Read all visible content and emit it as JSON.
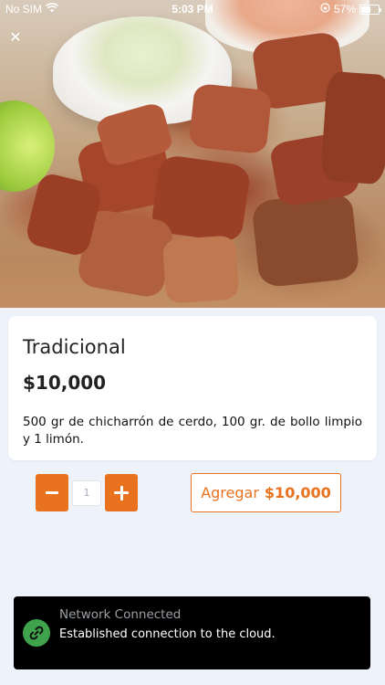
{
  "status_bar": {
    "carrier": "No SIM",
    "time": "5:03 PM",
    "battery_percent": "57%",
    "battery_level": 0.57
  },
  "product": {
    "name": "Tradicional",
    "price": "$10,000",
    "description": "500 gr de chicharrón de cerdo, 100 gr. de bollo limpio y 1 limón."
  },
  "quantity": {
    "value": "1"
  },
  "add_button": {
    "label": "Agregar",
    "amount": "$10,000"
  },
  "toast": {
    "title": "Network Connected",
    "message": "Established connection to the cloud."
  },
  "colors": {
    "accent": "#e8721e",
    "toast_bg": "#000000",
    "toast_icon": "#3fa34d",
    "page_bg": "#eef3fb"
  },
  "icons": {
    "close": "close-icon",
    "wifi": "wifi-icon",
    "toast": "link-icon"
  }
}
